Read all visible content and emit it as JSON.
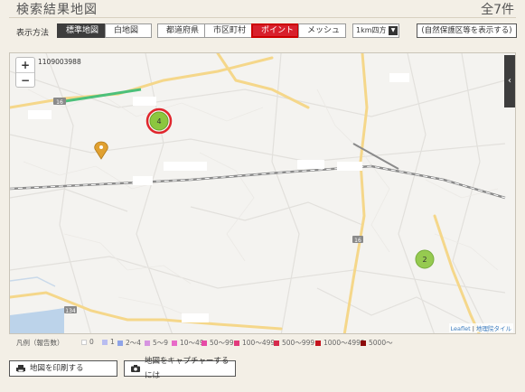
{
  "header": {
    "title": "検索結果地図",
    "total": "全7件"
  },
  "toolbar": {
    "display_label": "表示方法",
    "map_types": [
      "標準地図",
      "白地図"
    ],
    "area_types": [
      "都道府県",
      "市区町村",
      "ポイント",
      "メッシュ"
    ],
    "mesh_select": "1km四方",
    "nature_button": "(自然保護区等を表示する)"
  },
  "map": {
    "zoom_in": "+",
    "zoom_out": "−",
    "code": "1109003988",
    "side_tab_icon": "chevron-left-icon",
    "clusters": [
      "4",
      "2"
    ],
    "attribution_leaflet": "Leaflet",
    "attribution_sep": " | ",
    "attribution_tiles": "地理院タイル",
    "road_labels": [
      "16",
      "134",
      "16"
    ],
    "colors": {
      "cluster_fill": "#8cc63f",
      "cluster_highlight": "#e0262d",
      "pin": "#e0a030",
      "highway": "#4cc07a",
      "major_road": "#f5d78a"
    }
  },
  "legend": {
    "label": "凡例（報告数）",
    "items": [
      {
        "text": "0",
        "color": "#ffffff"
      },
      {
        "text": "1",
        "color": "#b9bdf0"
      },
      {
        "text": "2〜4",
        "color": "#8fa4e8"
      },
      {
        "text": "5〜9",
        "color": "#d694e0"
      },
      {
        "text": "10〜49",
        "color": "#e86ac8"
      },
      {
        "text": "50〜99",
        "color": "#e64aa6"
      },
      {
        "text": "100〜499",
        "color": "#e23a7c"
      },
      {
        "text": "500〜999",
        "color": "#d62a4c"
      },
      {
        "text": "1000〜4999",
        "color": "#c4141e"
      },
      {
        "text": "5000〜",
        "color": "#8c0a0a"
      }
    ]
  },
  "buttons": {
    "print": "地図を印刷する",
    "capture": "地図をキャプチャーするには"
  }
}
